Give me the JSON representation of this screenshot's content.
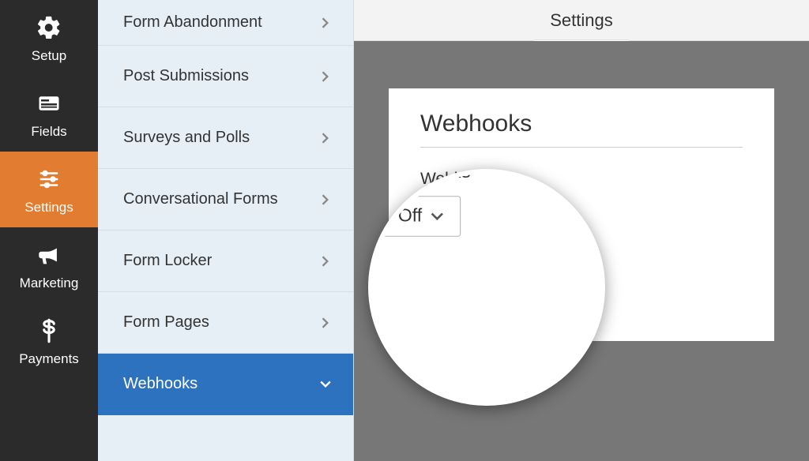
{
  "nav": {
    "items": [
      {
        "id": "setup",
        "label": "Setup",
        "active": false
      },
      {
        "id": "fields",
        "label": "Fields",
        "active": false
      },
      {
        "id": "settings",
        "label": "Settings",
        "active": true
      },
      {
        "id": "marketing",
        "label": "Marketing",
        "active": false
      },
      {
        "id": "payments",
        "label": "Payments",
        "active": false
      }
    ]
  },
  "header": {
    "title": "Settings"
  },
  "settings_list": {
    "items": [
      {
        "label": "Form Abandonment",
        "active": false
      },
      {
        "label": "Post Submissions",
        "active": false
      },
      {
        "label": "Surveys and Polls",
        "active": false
      },
      {
        "label": "Conversational Forms",
        "active": false
      },
      {
        "label": "Form Locker",
        "active": false
      },
      {
        "label": "Form Pages",
        "active": false
      },
      {
        "label": "Webhooks",
        "active": true
      }
    ]
  },
  "panel": {
    "title": "Webhooks",
    "field_label": "Webhooks",
    "dropdown_value": "Off"
  },
  "colors": {
    "nav_bg": "#2b2b2b",
    "accent": "#e27c30",
    "list_bg": "#e7eff6",
    "active_row": "#2d72be",
    "canvas": "#777"
  }
}
